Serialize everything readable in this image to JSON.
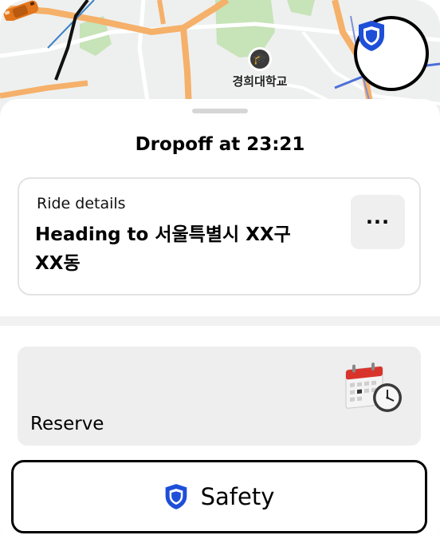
{
  "map": {
    "poi_label": "경희대학교",
    "poi_icon": "graduation-cap-icon",
    "vehicle_icon": "car-icon"
  },
  "safety_fab": {
    "icon": "shield-icon",
    "color": "#1e4fd8"
  },
  "sheet": {
    "dropoff_title": "Dropoff at 23:21",
    "ride_details": {
      "label": "Ride details",
      "destination": "Heading to 서울특별시 XX구 XX동",
      "more_label": "···"
    },
    "reserve": {
      "label": "Reserve",
      "icon": "calendar-clock-icon"
    },
    "safety_button": {
      "label": "Safety",
      "icon": "shield-icon"
    }
  }
}
